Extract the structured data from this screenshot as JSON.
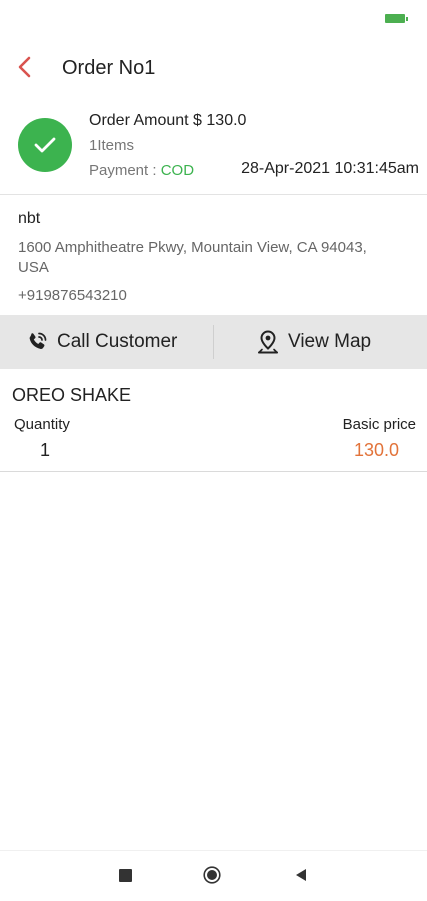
{
  "header": {
    "title": "Order No1"
  },
  "order": {
    "amount_text": "Order Amount $ 130.0",
    "items_text": "1Items",
    "payment_label": "Payment : ",
    "payment_method": "COD",
    "datetime": "28-Apr-2021 10:31:45am"
  },
  "customer": {
    "name": "nbt",
    "address": "1600 Amphitheatre Pkwy, Mountain View, CA 94043, USA",
    "phone": "+919876543210"
  },
  "actions": {
    "call_label": "Call Customer",
    "map_label": "View Map"
  },
  "item": {
    "name": "OREO SHAKE",
    "quantity_label": "Quantity",
    "quantity": "1",
    "price_label": "Basic price",
    "price": "130.0"
  },
  "icons": {
    "back": "chevron-left-icon",
    "status": "check-icon",
    "call": "phone-call-icon",
    "map": "map-pin-icon"
  },
  "colors": {
    "accent_red": "#d9534f",
    "success_green": "#3cb34f",
    "price_orange": "#e2733a"
  }
}
